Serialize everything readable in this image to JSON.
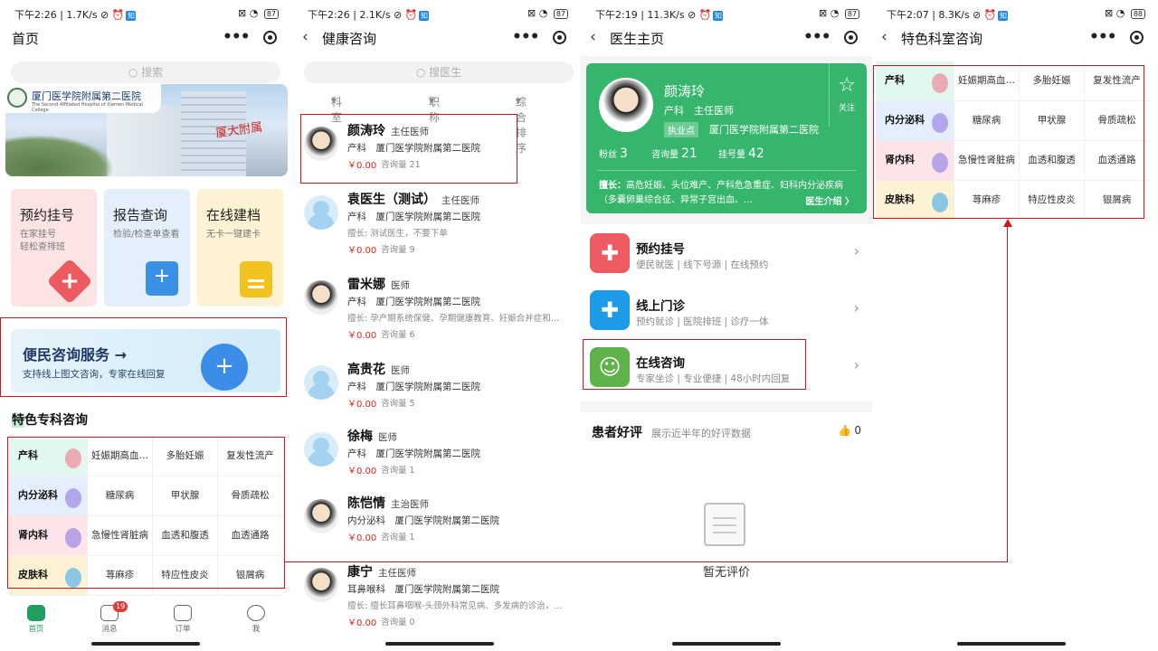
{
  "panel1": {
    "status": {
      "time": "下午2:26",
      "speed": "1.7K/s",
      "battery": "87"
    },
    "nav_title": "首页",
    "search_placeholder": "搜索",
    "banner": {
      "hospital_name": "厦门医学院附属第二医院",
      "hospital_sub": "The Second Affiliated Hospital of Xiamen Medical College",
      "sign_text": "厦大附属"
    },
    "cards": [
      {
        "title": "预约挂号",
        "sub1": "在家挂号",
        "sub2": "轻松查排班"
      },
      {
        "title": "报告查询",
        "sub1": "检验/检查单查看",
        "sub2": ""
      },
      {
        "title": "在线建档",
        "sub1": "无卡一键建卡",
        "sub2": ""
      }
    ],
    "service_banner": {
      "title": "便民咨询服务",
      "subtitle": "支持线上图文咨询，专家在线回复"
    },
    "section_title_first": "特",
    "section_title_rest": "色专科咨询",
    "tabs": [
      {
        "label": "首页"
      },
      {
        "label": "消息",
        "badge": "19"
      },
      {
        "label": "订单"
      },
      {
        "label": "我"
      }
    ]
  },
  "departments": [
    {
      "name": "产科",
      "color": "#e2f7ef",
      "icon_color": "#f08a9a",
      "items": [
        "妊娠期高血…",
        "多胎妊娠",
        "复发性流产"
      ]
    },
    {
      "name": "内分泌科",
      "color": "#e4eefc",
      "icon_color": "#9b8ae6",
      "items": [
        "糖尿病",
        "甲状腺",
        "骨质疏松"
      ]
    },
    {
      "name": "肾内科",
      "color": "#fde4e8",
      "icon_color": "#9b8ae6",
      "items": [
        "急慢性肾脏病",
        "血透和腹透",
        "血透通路"
      ]
    },
    {
      "name": "皮肤科",
      "color": "#fdf3d4",
      "icon_color": "#5ab4e8",
      "items": [
        "荨麻疹",
        "特应性皮炎",
        "银屑病"
      ]
    }
  ],
  "panel2": {
    "status": {
      "time": "下午2:26",
      "speed": "2.1K/s",
      "battery": "87"
    },
    "nav_title": "健康咨询",
    "search_placeholder": "搜医生",
    "filters": [
      "科室",
      "职称",
      "综合排序"
    ],
    "doctors": [
      {
        "name": "颜涛玲",
        "title": "主任医师",
        "dept": "产科",
        "hospital": "厦门医学院附属第二医院",
        "specialty": "",
        "price": "￥0.00",
        "consult": "咨询量 21",
        "photo": true
      },
      {
        "name": "袁医生（测试）",
        "title": "主任医师",
        "dept": "产科",
        "hospital": "厦门医学院附属第二医院",
        "specialty": "擅长: 测试医生，不要下单",
        "price": "￥0.00",
        "consult": "咨询量 9",
        "photo": false
      },
      {
        "name": "雷米娜",
        "title": "医师",
        "dept": "产科",
        "hospital": "厦门医学院附属第二医院",
        "specialty": "擅长: 孕产期系统保健、孕期健康教育、妊娠合并症和…",
        "price": "￥0.00",
        "consult": "咨询量 6",
        "photo": true
      },
      {
        "name": "高贵花",
        "title": "医师",
        "dept": "产科",
        "hospital": "厦门医学院附属第二医院",
        "specialty": "",
        "price": "￥0.00",
        "consult": "咨询量 5",
        "photo": false
      },
      {
        "name": "徐梅",
        "title": "医师",
        "dept": "产科",
        "hospital": "厦门医学院附属第二医院",
        "specialty": "",
        "price": "￥0.00",
        "consult": "咨询量 1",
        "photo": false
      },
      {
        "name": "陈恺情",
        "title": "主治医师",
        "dept": "内分泌科",
        "hospital": "厦门医学院附属第二医院",
        "specialty": "",
        "price": "￥0.00",
        "consult": "咨询量 1",
        "photo": true
      },
      {
        "name": "康宁",
        "title": "主任医师",
        "dept": "耳鼻喉科",
        "hospital": "厦门医学院附属第二医院",
        "specialty": "擅长: 擅长耳鼻咽喉-头颈外科常见病、多发病的诊治，…",
        "price": "￥0.00",
        "consult": "咨询量 0",
        "photo": true
      }
    ]
  },
  "panel3": {
    "status": {
      "time": "下午2:19",
      "speed": "11.3K/s",
      "battery": "87"
    },
    "nav_title": "医生主页",
    "profile": {
      "name": "颜涛玲",
      "dept_title": "产科　主任医师",
      "tag": "执业点",
      "hospital": "厦门医学院附属第二医院",
      "follow": "关注",
      "stats": [
        {
          "label": "粉丝",
          "value": "3"
        },
        {
          "label": "咨询量",
          "value": "21"
        },
        {
          "label": "挂号量",
          "value": "42"
        }
      ],
      "specialty_label": "擅长：",
      "specialty": "高危妊娠、头位难产、产科危急重症、妇科内分泌疾病（多囊卵巢综合征、异常子宫出血、…",
      "intro_link": "医生介绍 〉"
    },
    "services": [
      {
        "name": "预约挂号",
        "desc": "便民就医 | 线下号源 | 在线预约",
        "color": "#ef5b62",
        "glyph": "✚"
      },
      {
        "name": "线上门诊",
        "desc": "预约就诊 | 医院排班 | 诊疗一体",
        "color": "#1e9be8",
        "glyph": "✚"
      },
      {
        "name": "在线咨询",
        "desc": "专家坐诊 | 专业便捷 | 48小时内回复",
        "color": "#5fb14a",
        "glyph": "☺"
      }
    ],
    "review": {
      "title": "患者好评",
      "subtitle": "展示近半年的好评数据",
      "count": "0",
      "empty_text": "暂无评价"
    }
  },
  "panel4": {
    "status": {
      "time": "下午2:07",
      "speed": "8.3K/s",
      "battery": "88"
    },
    "nav_title": "特色科室咨询"
  }
}
